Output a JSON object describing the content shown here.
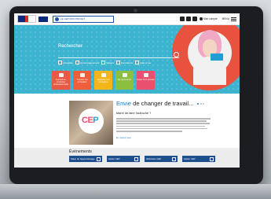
{
  "header": {
    "banner_text": "LE CEP MON PROJET",
    "account_label": "Mon compte",
    "menu_label": "MENU",
    "icons": [
      "youtube-icon",
      "facebook-icon",
      "search-icon",
      "user-icon",
      "hamburger-icon"
    ]
  },
  "hero": {
    "search_label": "Rechercher",
    "filters": [
      "Actualités",
      "Accompagnement",
      "Métiers",
      "Formations",
      "Aide et vie"
    ],
    "tiles": [
      {
        "label": "Conseil en évolution professionnelle",
        "color": "#e85a45"
      },
      {
        "label": "Trouver ma formation",
        "color": "#ef5f3c"
      },
      {
        "label": "Financer ma formation",
        "color": "#f2b61b"
      },
      {
        "label": "Se reconvertir",
        "color": "#8cbf3f"
      },
      {
        "label": "Créer mon activité",
        "color": "#e94f6e"
      }
    ]
  },
  "content": {
    "logo_text_a": "CE",
    "logo_text_b": "P",
    "heading_a": "Envie",
    "heading_b": "de changer de travail...",
    "subheading": "Marre de faire l'autruche ?",
    "read_more": "En savoir plus"
  },
  "events": {
    "title": "Événements",
    "items": [
      {
        "label": "Salon de l'apprentissage"
      },
      {
        "label": "Atelier CEP"
      },
      {
        "label": "Webinaire CEP"
      },
      {
        "label": "Atelier CEP"
      }
    ]
  },
  "colors": {
    "hero_bg": "#3db4cf",
    "accent": "#1e7bc2",
    "ring": "#e8533f"
  }
}
